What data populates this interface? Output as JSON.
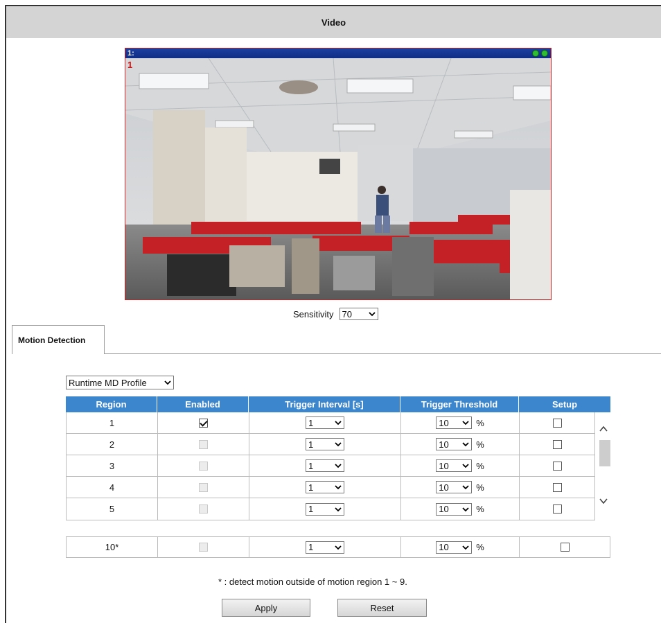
{
  "page": {
    "title": "Video"
  },
  "video": {
    "channel_label": "1:",
    "region_marker": "1"
  },
  "sensitivity": {
    "label": "Sensitivity",
    "value": "70"
  },
  "tabs": [
    {
      "label": "Motion Detection",
      "active": true
    }
  ],
  "profile": {
    "selected": "Runtime MD Profile"
  },
  "table": {
    "columns": [
      "Region",
      "Enabled",
      "Trigger Interval [s]",
      "Trigger Threshold",
      "Setup"
    ],
    "rows": [
      {
        "region": "1",
        "enabled": true,
        "enabled_disabled": false,
        "interval": "1",
        "threshold": "10",
        "unit": "%",
        "setup": false
      },
      {
        "region": "2",
        "enabled": false,
        "enabled_disabled": true,
        "interval": "1",
        "threshold": "10",
        "unit": "%",
        "setup": false
      },
      {
        "region": "3",
        "enabled": false,
        "enabled_disabled": true,
        "interval": "1",
        "threshold": "10",
        "unit": "%",
        "setup": false
      },
      {
        "region": "4",
        "enabled": false,
        "enabled_disabled": true,
        "interval": "1",
        "threshold": "10",
        "unit": "%",
        "setup": false
      },
      {
        "region": "5",
        "enabled": false,
        "enabled_disabled": true,
        "interval": "1",
        "threshold": "10",
        "unit": "%",
        "setup": false
      }
    ],
    "outside_row": {
      "region": "10*",
      "enabled": false,
      "interval": "1",
      "threshold": "10",
      "unit": "%",
      "setup": false
    }
  },
  "note": "* : detect motion outside of motion region 1 ~ 9.",
  "buttons": {
    "apply": "Apply",
    "reset": "Reset"
  },
  "colors": {
    "header_bg": "#d4d4d4",
    "table_header": "#3c86ce",
    "video_titlebar": "#1d3f9f"
  },
  "icons": {
    "dropdown": "chevron-down-icon",
    "scroll_up": "chevron-up-icon",
    "scroll_down": "chevron-down-icon",
    "status": "status-dot-icon"
  }
}
